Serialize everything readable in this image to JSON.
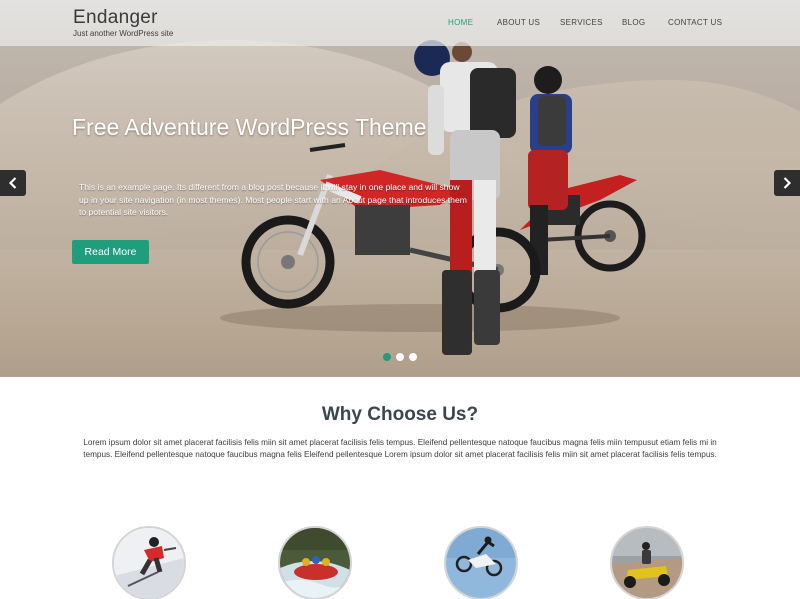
{
  "site": {
    "title": "Endanger",
    "tagline": "Just another WordPress site"
  },
  "nav": {
    "items": [
      {
        "label": "HOME",
        "active": true
      },
      {
        "label": "ABOUT US",
        "active": false
      },
      {
        "label": "SERVICES",
        "active": false
      },
      {
        "label": "BLOG",
        "active": false
      },
      {
        "label": "CONTACT US",
        "active": false
      }
    ]
  },
  "slider": {
    "title": "Free Adventure WordPress Theme",
    "text": "This is an example page. Its different from a blog post because it will stay in one place and will show up in your site navigation (in most themes). Most people start with an About page that introduces them to potential site visitors.",
    "button_label": "Read More",
    "prev_icon": "chevron-left-icon",
    "next_icon": "chevron-right-icon",
    "dots": [
      {
        "active": true
      },
      {
        "active": false
      },
      {
        "active": false
      }
    ]
  },
  "why": {
    "title": "Why Choose Us?",
    "text": "Lorem ipsum dolor sit amet placerat facilisis felis miin sit amet placerat facilisis felis tempus. Eleifend pellentesque natoque faucibus magna felis miin tempusut etiam felis mi in tempus. Eleifend pellentesque natoque faucibus magna felis Eleifend pellentesque Lorem ipsum dolor sit amet placerat facilisis felis miin sit amet placerat facilisis felis tempus."
  },
  "features": [
    {
      "image": "skier-image"
    },
    {
      "image": "rafting-image"
    },
    {
      "image": "motocross-jump-image"
    },
    {
      "image": "atv-rider-image"
    }
  ],
  "colors": {
    "accent": "#1e9e7c",
    "nav_text": "#444444",
    "heading": "#3a4650"
  }
}
